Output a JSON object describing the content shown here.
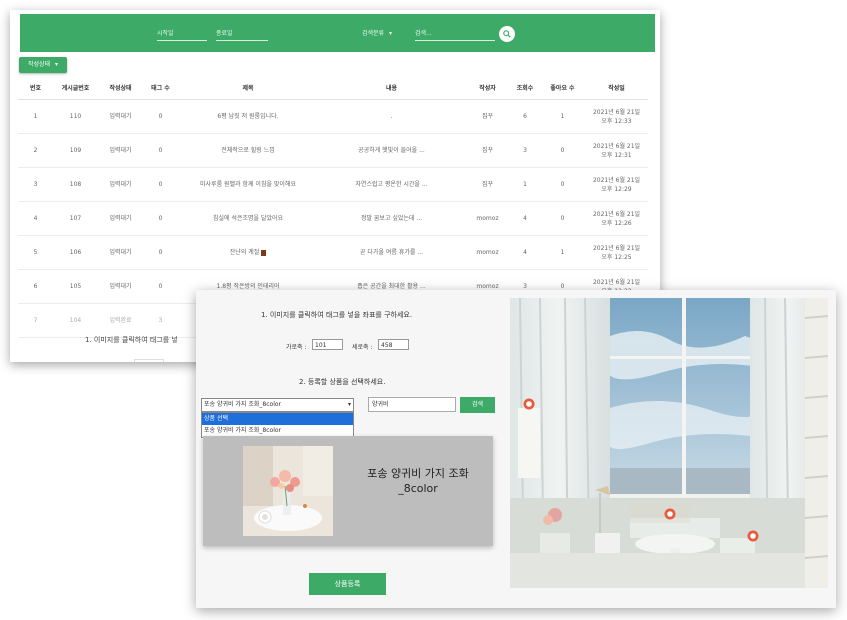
{
  "search_bar": {
    "start_date": "시작일",
    "end_date": "종료일",
    "search_category": "검색분류",
    "search_placeholder": "검색..."
  },
  "filter": {
    "status_label": "작성상태"
  },
  "table": {
    "headers": [
      "번호",
      "게시글번호",
      "작성상태",
      "태그 수",
      "제목",
      "내용",
      "작성자",
      "조회수",
      "좋아요 수",
      "작성일"
    ],
    "rows": [
      {
        "no": "1",
        "post_no": "110",
        "status": "입력대기",
        "tags": "0",
        "title": "6평 남짓 저 원룸입니다.",
        "content": ".",
        "author": "집꾸",
        "views": "6",
        "likes": "1",
        "date1": "2021년 6월 21일",
        "date2": "오후 12:33"
      },
      {
        "no": "2",
        "post_no": "109",
        "status": "입력대기",
        "tags": "0",
        "title": "전체적으로 힐링 느낌",
        "content": "공공하게 햇빛이 들어올 ...",
        "author": "집꾸",
        "views": "3",
        "likes": "0",
        "date1": "2021년 6월 21일",
        "date2": "오후 12:31"
      },
      {
        "no": "3",
        "post_no": "108",
        "status": "입력대기",
        "tags": "0",
        "title": "미사루룸 원벨과 함께 이침을 맞이해요",
        "content": "자연스럽고 평온한 시간을 ...",
        "author": "집꾸",
        "views": "1",
        "likes": "0",
        "date1": "2021년 6월 21일",
        "date2": "오후 12:29"
      },
      {
        "no": "4",
        "post_no": "107",
        "status": "입력대기",
        "tags": "0",
        "title": "침실에 석은조명을 달았어요",
        "content": "정말 꿈보고 싶었는데 ...",
        "author": "momoz",
        "views": "4",
        "likes": "0",
        "date1": "2021년 6월 21일",
        "date2": "오후 12:26"
      },
      {
        "no": "5",
        "post_no": "106",
        "status": "입력대기",
        "tags": "0",
        "title": "잔냔의 계절",
        "content": "곧 다가올 여름 휴가를 ...",
        "author": "momoz",
        "views": "4",
        "likes": "1",
        "date1": "2021년 6월 21일",
        "date2": "오후 12:25"
      },
      {
        "no": "6",
        "post_no": "105",
        "status": "입력대기",
        "tags": "0",
        "title": "1.8평 작은방의 인테리어",
        "content": "좁은 공간을 최대한 활용 ...",
        "author": "momoz",
        "views": "3",
        "likes": "0",
        "date1": "2021년 6월 21일",
        "date2": "오후 12:23"
      },
      {
        "no": "7",
        "post_no": "104",
        "status": "입력완료",
        "tags": "3",
        "title": "",
        "content": "",
        "author": "",
        "views": "",
        "likes": "",
        "date1": "",
        "date2": ""
      }
    ]
  },
  "back_instruction": "1. 이미지를 클릭하여 태그를 넣",
  "form": {
    "step1": "1. 이미지를 클릭하여 태그를 넣을 좌표를 구하세요.",
    "x_label": "가로축 :",
    "x_value": "101",
    "y_label": "세로축 :",
    "y_value": "458",
    "step2": "2. 등록할 상품을 선택하세요.",
    "selected_product": "포송 양귀비 가지 조화_8color",
    "dropdown_options": [
      "상품 선택",
      "포송 양귀비 가지 조화_8color"
    ],
    "search_value": "양귀비",
    "search_button": "검색",
    "product_name_line1": "포송 양귀비 가지 조화",
    "product_name_line2": "_8color",
    "register_button": "상품등록"
  },
  "colors": {
    "accent": "#3daa68",
    "marker": "#e85a3c",
    "select_highlight": "#1e6fd9"
  }
}
